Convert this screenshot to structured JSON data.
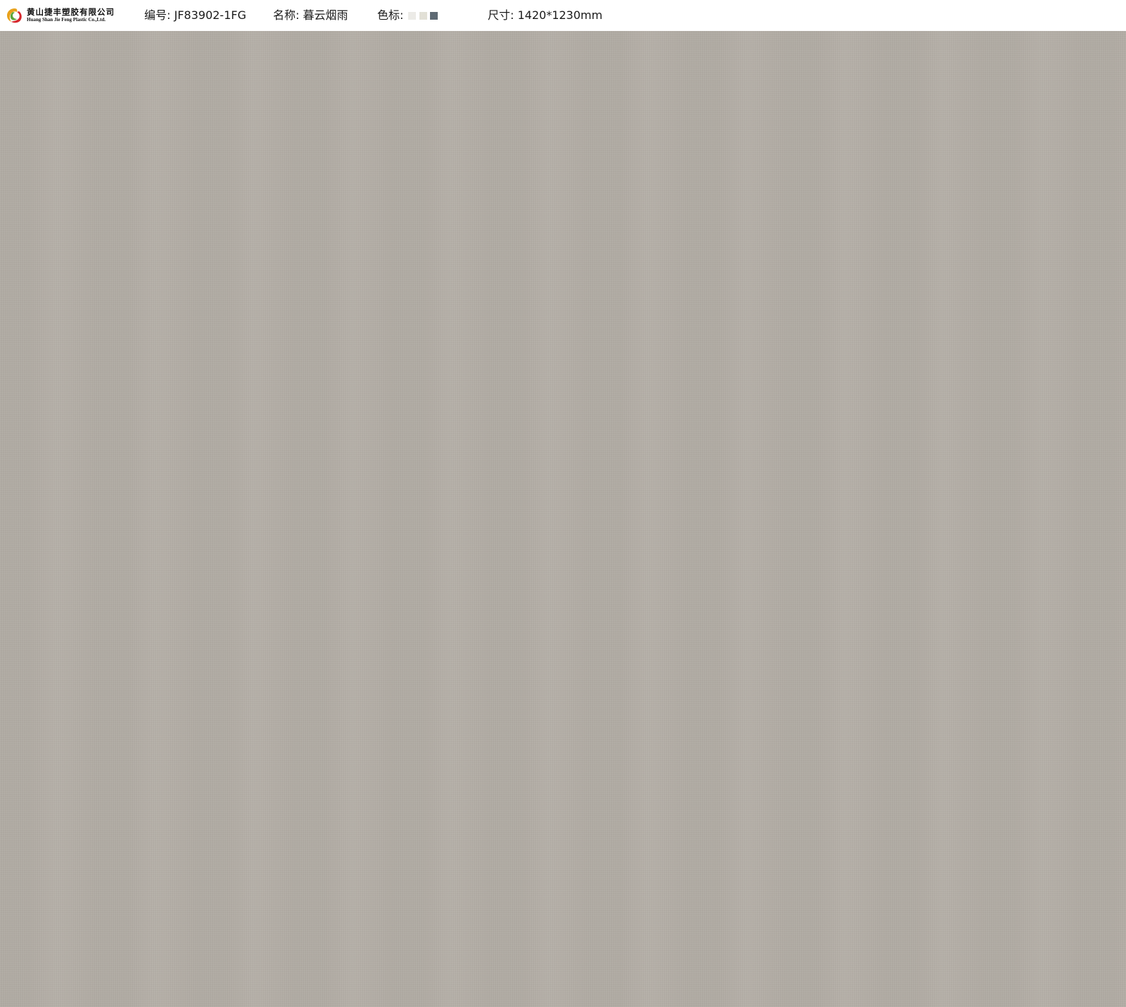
{
  "header": {
    "logo": {
      "name_cn": "黄山捷丰塑胶有限公司",
      "name_en": "Huang Shan Jie Feng Plastic Co.,Ltd."
    },
    "code_label": "编号: JF83902-1FG",
    "name_label": "名称: 暮云烟雨",
    "color_label": "色标:",
    "size_label": "尺寸:  1420*1230mm"
  },
  "swatches": [
    "#ecebe7",
    "#e2e0d6",
    "#5e6a73"
  ],
  "texture_color": "#b3ada5"
}
